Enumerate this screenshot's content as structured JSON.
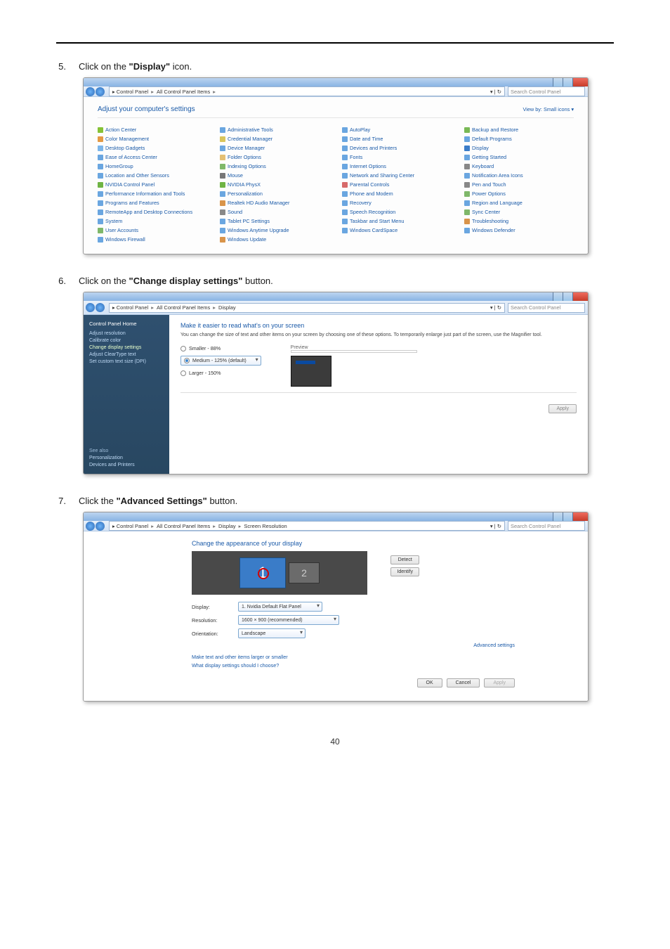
{
  "page_number": "40",
  "steps": [
    {
      "num": "5.",
      "pre": "Click on the ",
      "bold": "\"Display\"",
      "post": " icon."
    },
    {
      "num": "6.",
      "pre": "Click on the ",
      "bold": "\"Change display settings\"",
      "post": " button."
    },
    {
      "num": "7.",
      "pre": "Click the ",
      "bold": "\"Advanced Settings\"",
      "post": " button."
    }
  ],
  "s1": {
    "breadcrumb": [
      "Control Panel",
      "All Control Panel Items"
    ],
    "search_placeholder": "Search Control Panel",
    "title": "Adjust your computer's settings",
    "view": "View by:  Small icons ▾",
    "items": [
      [
        "Action Center",
        "#86c236"
      ],
      [
        "Administrative Tools",
        "#6aa6e0"
      ],
      [
        "AutoPlay",
        "#6aa6e0"
      ],
      [
        "Backup and Restore",
        "#79b955"
      ],
      [
        "Color Management",
        "#e49a44"
      ],
      [
        "Credential Manager",
        "#d9c65c"
      ],
      [
        "Date and Time",
        "#6aa6e0"
      ],
      [
        "Default Programs",
        "#6aa6e0"
      ],
      [
        "Desktop Gadgets",
        "#7cb6ea"
      ],
      [
        "Device Manager",
        "#6aa6e0"
      ],
      [
        "Devices and Printers",
        "#6aa6e0"
      ],
      [
        "Display",
        "#3a7cc8"
      ],
      [
        "Ease of Access Center",
        "#6aa6e0"
      ],
      [
        "Folder Options",
        "#e4c074"
      ],
      [
        "Fonts",
        "#6aa6e0"
      ],
      [
        "Getting Started",
        "#6aa6e0"
      ],
      [
        "HomeGroup",
        "#6aa6e0"
      ],
      [
        "Indexing Options",
        "#7fb86a"
      ],
      [
        "Internet Options",
        "#6aa6e0"
      ],
      [
        "Keyboard",
        "#888888"
      ],
      [
        "Location and Other Sensors",
        "#6aa6e0"
      ],
      [
        "Mouse",
        "#777777"
      ],
      [
        "Network and Sharing Center",
        "#6aa6e0"
      ],
      [
        "Notification Area Icons",
        "#6aa6e0"
      ],
      [
        "NVIDIA Control Panel",
        "#6fb444"
      ],
      [
        "NVIDIA PhysX",
        "#6fb444"
      ],
      [
        "Parental Controls",
        "#d76a6a"
      ],
      [
        "Pen and Touch",
        "#888888"
      ],
      [
        "Performance Information and Tools",
        "#6aa6e0"
      ],
      [
        "Personalization",
        "#6aa6e0"
      ],
      [
        "Phone and Modem",
        "#6aa6e0"
      ],
      [
        "Power Options",
        "#7fb86a"
      ],
      [
        "Programs and Features",
        "#6aa6e0"
      ],
      [
        "Realtek HD Audio Manager",
        "#d9944a"
      ],
      [
        "Recovery",
        "#6aa6e0"
      ],
      [
        "Region and Language",
        "#6aa6e0"
      ],
      [
        "RemoteApp and Desktop Connections",
        "#6aa6e0"
      ],
      [
        "Sound",
        "#888888"
      ],
      [
        "Speech Recognition",
        "#6aa6e0"
      ],
      [
        "Sync Center",
        "#7fb86a"
      ],
      [
        "System",
        "#6aa6e0"
      ],
      [
        "Tablet PC Settings",
        "#6aa6e0"
      ],
      [
        "Taskbar and Start Menu",
        "#6aa6e0"
      ],
      [
        "Troubleshooting",
        "#d9944a"
      ],
      [
        "User Accounts",
        "#7fb86a"
      ],
      [
        "Windows Anytime Upgrade",
        "#6aa6e0"
      ],
      [
        "Windows CardSpace",
        "#6aa6e0"
      ],
      [
        "Windows Defender",
        "#6aa6e0"
      ],
      [
        "Windows Firewall",
        "#6aa6e0"
      ],
      [
        "Windows Update",
        "#d9944a"
      ]
    ]
  },
  "s2": {
    "breadcrumb": [
      "Control Panel",
      "All Control Panel Items",
      "Display"
    ],
    "search_placeholder": "Search Control Panel",
    "sidebar_title": "Control Panel Home",
    "sidebar_links": [
      {
        "t": "Adjust resolution",
        "a": false
      },
      {
        "t": "Calibrate color",
        "a": false
      },
      {
        "t": "Change display settings",
        "a": true
      },
      {
        "t": "Adjust ClearType text",
        "a": false
      },
      {
        "t": "Set custom text size (DPI)",
        "a": false
      }
    ],
    "see_also": "See also",
    "see_also_links": [
      "Personalization",
      "Devices and Printers"
    ],
    "heading": "Make it easier to read what's on your screen",
    "desc": "You can change the size of text and other items on your screen by choosing one of these options. To temporarily enlarge just part of the screen, use the Magnifier tool.",
    "radios": [
      {
        "label": "Smaller - 88%",
        "sel": false
      },
      {
        "label": "Medium - 125% (default)",
        "sel": true
      },
      {
        "label": "Larger - 150%",
        "sel": false
      }
    ],
    "preview_label": "Preview",
    "apply": "Apply"
  },
  "s3": {
    "breadcrumb": [
      "Control Panel",
      "All Control Panel Items",
      "Display",
      "Screen Resolution"
    ],
    "search_placeholder": "Search Control Panel",
    "heading": "Change the appearance of your display",
    "detect": "Detect",
    "identify": "Identify",
    "mon1": "1",
    "mon2": "2",
    "fields": [
      {
        "label": "Display:",
        "val": "1. Nvidia Default Flat Panel",
        "w": "w1"
      },
      {
        "label": "Resolution:",
        "val": "1600 × 900 (recommended)",
        "w": "w2"
      },
      {
        "label": "Orientation:",
        "val": "Landscape",
        "w": "w3"
      }
    ],
    "adv": "Advanced settings",
    "links": [
      "Make text and other items larger or smaller",
      "What display settings should I choose?"
    ],
    "ok": "OK",
    "cancel": "Cancel",
    "apply": "Apply"
  }
}
